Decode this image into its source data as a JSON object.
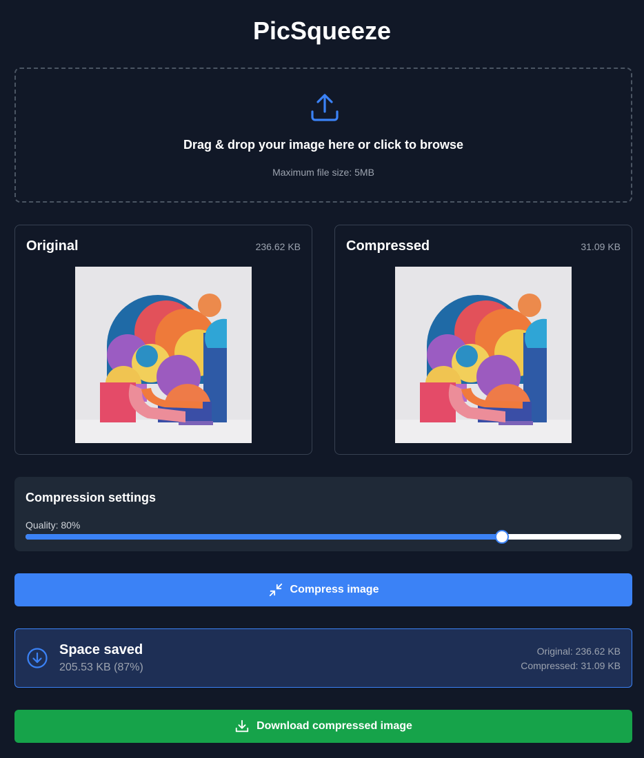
{
  "app": {
    "title": "PicSqueeze"
  },
  "dropzone": {
    "icon": "upload-icon",
    "text": "Drag & drop your image here or click to browse",
    "hint": "Maximum file size: 5MB"
  },
  "original": {
    "title": "Original",
    "size": "236.62 KB"
  },
  "compressed": {
    "title": "Compressed",
    "size": "31.09 KB"
  },
  "settings": {
    "title": "Compression settings",
    "quality_label": "Quality: 80%",
    "quality": 0.8
  },
  "compress_button": {
    "icon": "compress-icon",
    "label": "Compress image"
  },
  "savings": {
    "icon": "arrow-down-circle-icon",
    "title": "Space saved",
    "amount": "205.53 KB (87%)",
    "original_line": "Original: 236.62 KB",
    "compressed_line": "Compressed: 31.09 KB"
  },
  "download_button": {
    "icon": "download-icon",
    "label": "Download compressed image"
  },
  "colors": {
    "background": "#111827",
    "card": "#1f2937",
    "accent": "#3b82f6",
    "success": "#16a34a",
    "muted": "#9ca3af"
  }
}
